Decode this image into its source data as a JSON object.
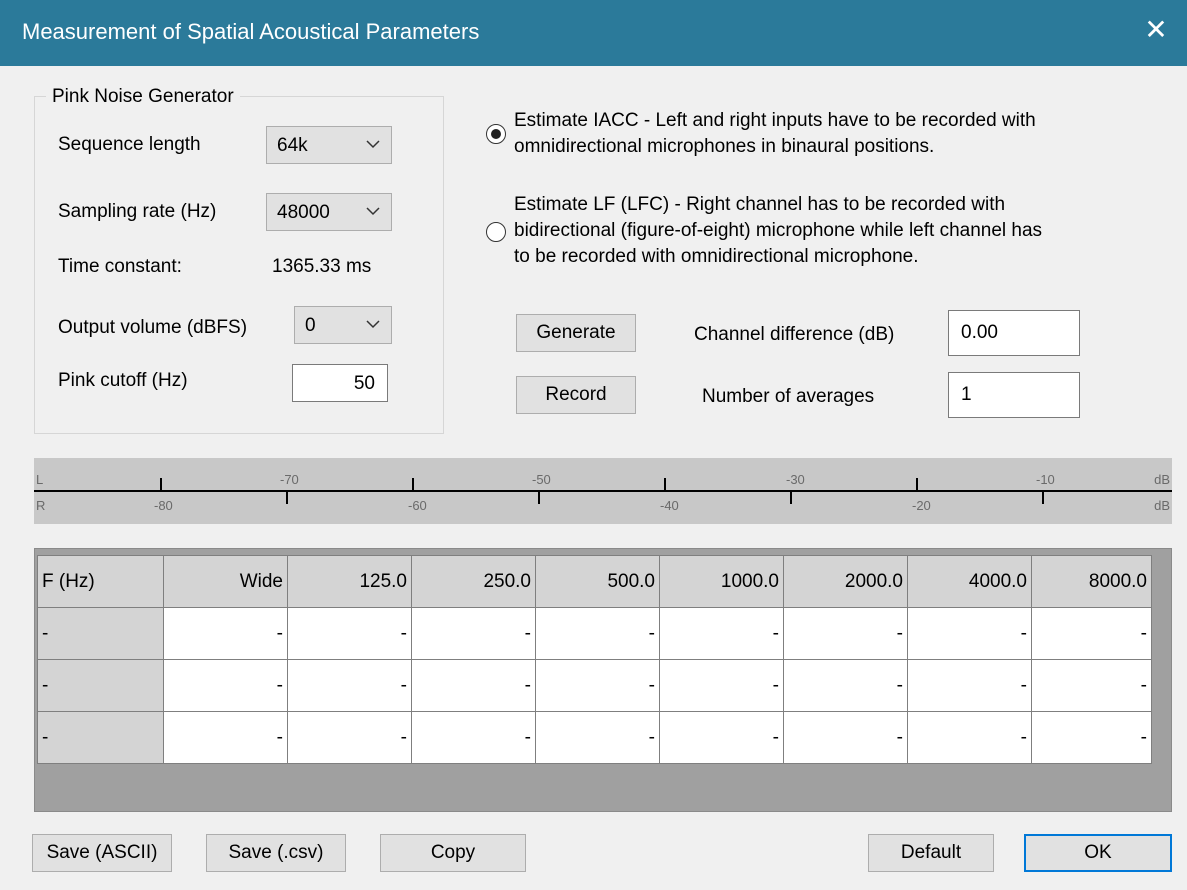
{
  "window": {
    "title": "Measurement of Spatial Acoustical Parameters"
  },
  "pink_noise": {
    "group_title": "Pink Noise Generator",
    "sequence_length_label": "Sequence length",
    "sequence_length_value": "64k",
    "sampling_rate_label": "Sampling rate (Hz)",
    "sampling_rate_value": "48000",
    "time_constant_label": "Time constant:",
    "time_constant_value": "1365.33 ms",
    "output_volume_label": "Output volume (dBFS)",
    "output_volume_value": "0",
    "pink_cutoff_label": "Pink cutoff (Hz)",
    "pink_cutoff_value": "50"
  },
  "mode": {
    "iacc_line1": "Estimate IACC - Left and right inputs have to be recorded with",
    "iacc_line2": "omnidirectional microphones in binaural positions.",
    "iacc_selected": true,
    "lf_line1": "Estimate LF (LFC) - Right channel has to be recorded with",
    "lf_line2": "bidirectional (figure-of-eight) microphone while left channel has",
    "lf_line3": "to be recorded with omnidirectional microphone.",
    "lf_selected": false
  },
  "controls": {
    "generate_label": "Generate",
    "record_label": "Record",
    "channel_diff_label": "Channel difference (dB)",
    "channel_diff_value": "0.00",
    "num_averages_label": "Number of averages",
    "num_averages_value": "1"
  },
  "meter": {
    "left_channel": "L",
    "right_channel": "R",
    "unit": "dB",
    "left_labels": [
      "-70",
      "-50",
      "-30",
      "-10"
    ],
    "right_labels": [
      "-80",
      "-60",
      "-40",
      "-20"
    ]
  },
  "table": {
    "headers": [
      "F (Hz)",
      "Wide",
      "125.0",
      "250.0",
      "500.0",
      "1000.0",
      "2000.0",
      "4000.0",
      "8000.0"
    ],
    "rows": [
      [
        "-",
        "-",
        "-",
        "-",
        "-",
        "-",
        "-",
        "-",
        "-"
      ],
      [
        "-",
        "-",
        "-",
        "-",
        "-",
        "-",
        "-",
        "-",
        "-"
      ],
      [
        "-",
        "-",
        "-",
        "-",
        "-",
        "-",
        "-",
        "-",
        "-"
      ]
    ]
  },
  "footer": {
    "save_ascii": "Save (ASCII)",
    "save_csv": "Save (.csv)",
    "copy": "Copy",
    "default": "Default",
    "ok": "OK"
  },
  "icons": {
    "close": "close-icon",
    "chevron": "chevron-down-icon"
  }
}
